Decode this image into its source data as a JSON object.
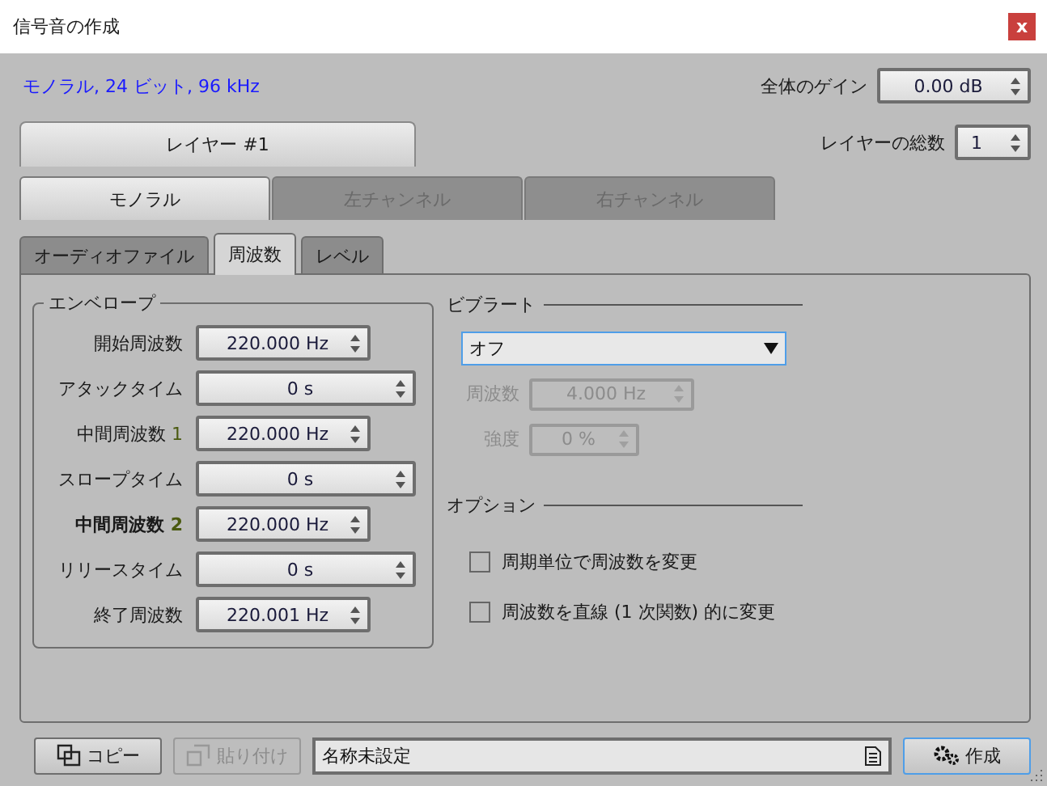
{
  "window": {
    "title": "信号音の作成",
    "close": "x"
  },
  "format": "モノラル, 24 ビット, 96 kHz",
  "gain": {
    "label": "全体のゲイン",
    "value": "0.00 dB"
  },
  "layer_tabs": [
    {
      "label": "レイヤー #1",
      "selected": true
    }
  ],
  "layer_count": {
    "label": "レイヤーの総数",
    "value": "1"
  },
  "channel_tabs": [
    {
      "label": "モノラル",
      "selected": true,
      "disabled": false
    },
    {
      "label": "左チャンネル",
      "selected": false,
      "disabled": true
    },
    {
      "label": "右チャンネル",
      "selected": false,
      "disabled": true
    }
  ],
  "tabs": [
    {
      "label": "オーディオファイル",
      "selected": false
    },
    {
      "label": "周波数",
      "selected": true
    },
    {
      "label": "レベル",
      "selected": false
    }
  ],
  "envelope": {
    "title": "エンベロープ",
    "rows": [
      {
        "label": "開始周波数",
        "value": "220.000 Hz",
        "kind": "frequency",
        "bold": false
      },
      {
        "label": "アタックタイム",
        "value": "0 s",
        "kind": "time",
        "bold": false
      },
      {
        "label": "中間周波数",
        "index": "1",
        "value": "220.000 Hz",
        "kind": "frequency",
        "bold": false
      },
      {
        "label": "スロープタイム",
        "value": "0 s",
        "kind": "time",
        "bold": false
      },
      {
        "label": "中間周波数",
        "index": "2",
        "value": "220.000 Hz",
        "kind": "frequency",
        "bold": true
      },
      {
        "label": "リリースタイム",
        "value": "0 s",
        "kind": "time",
        "bold": false
      },
      {
        "label": "終了周波数",
        "value": "220.001 Hz",
        "kind": "frequency",
        "bold": false
      }
    ]
  },
  "vibrato": {
    "title": "ビブラート",
    "mode": "オフ",
    "fields": [
      {
        "label": "周波数",
        "value": "4.000 Hz",
        "kind": "wide",
        "disabled": true
      },
      {
        "label": "強度",
        "value": "0 %",
        "kind": "narrow",
        "disabled": true
      }
    ]
  },
  "options": {
    "title": "オプション",
    "items": [
      {
        "label": "周期単位で周波数を変更",
        "checked": false
      },
      {
        "label": "周波数を直線 (1 次関数) 的に変更",
        "checked": false
      }
    ]
  },
  "footer": {
    "copy": "コピー",
    "paste": {
      "label": "貼り付け",
      "disabled": true
    },
    "name": "名称未設定",
    "create": "作成"
  }
}
